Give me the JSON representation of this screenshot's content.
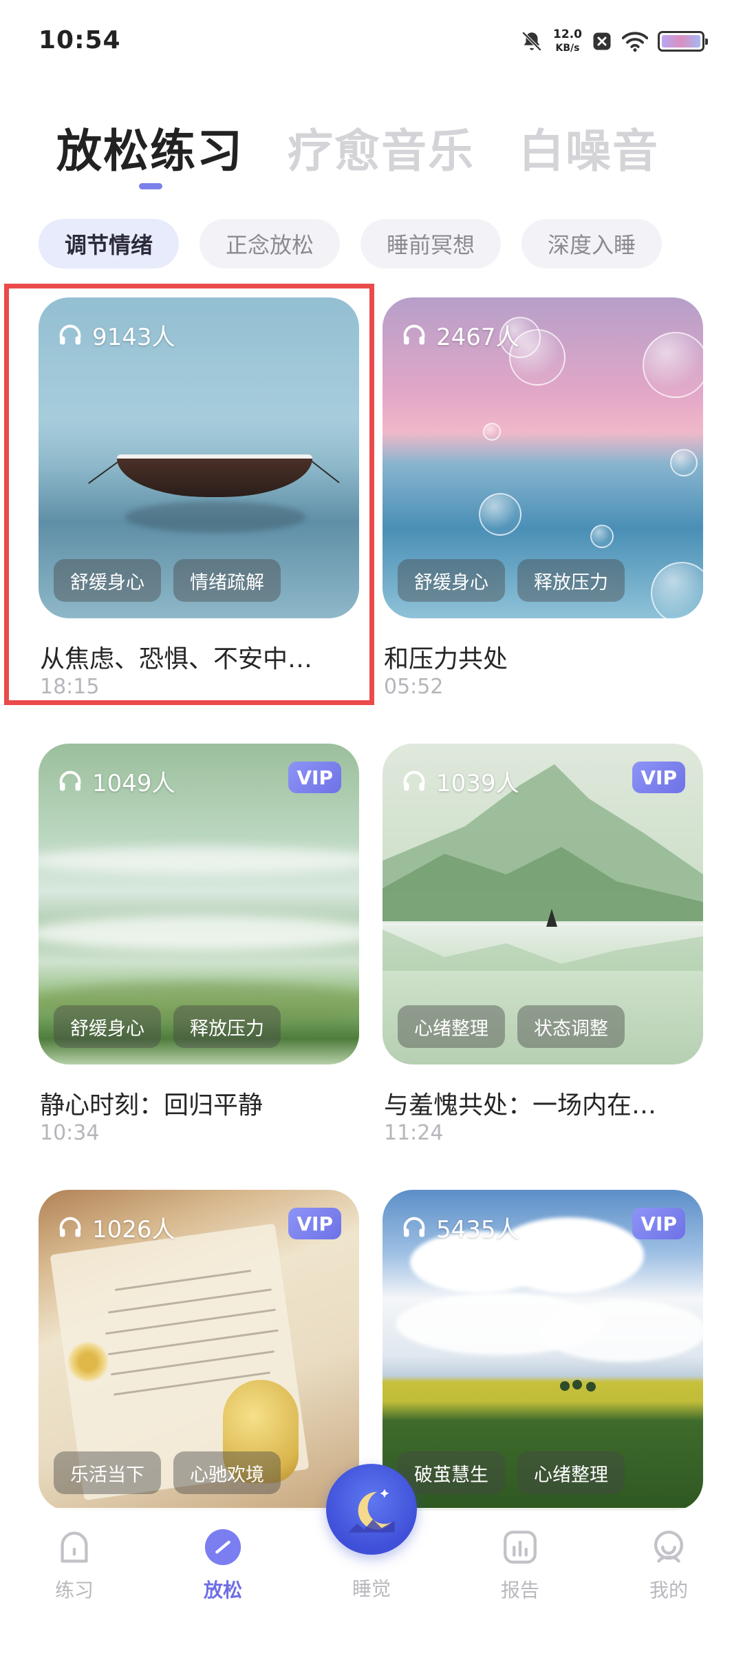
{
  "status_bar": {
    "time": "10:54",
    "speed_value": "12.0",
    "speed_unit": "KB/s",
    "battery_level": 1.0
  },
  "top_tabs": [
    {
      "label": "放松练习",
      "active": true
    },
    {
      "label": "疗愈音乐",
      "active": false
    },
    {
      "label": "白噪音",
      "active": false
    }
  ],
  "chips": [
    {
      "label": "调节情绪",
      "active": true
    },
    {
      "label": "正念放松",
      "active": false
    },
    {
      "label": "睡前冥想",
      "active": false
    },
    {
      "label": "深度入睡",
      "active": false
    }
  ],
  "cards": [
    {
      "listeners": "9143人",
      "vip": false,
      "tags": [
        "舒缓身心",
        "情绪疏解"
      ],
      "title": "从焦虑、恐惧、不安中…",
      "duration": "18:15"
    },
    {
      "listeners": "2467人",
      "vip": false,
      "tags": [
        "舒缓身心",
        "释放压力"
      ],
      "title": "和压力共处",
      "duration": "05:52"
    },
    {
      "listeners": "1049人",
      "vip": true,
      "vip_label": "VIP",
      "tags": [
        "舒缓身心",
        "释放压力"
      ],
      "title": "静心时刻：回归平静",
      "duration": "10:34"
    },
    {
      "listeners": "1039人",
      "vip": true,
      "vip_label": "VIP",
      "tags": [
        "心绪整理",
        "状态调整"
      ],
      "title": "与羞愧共处：一场内在…",
      "duration": "11:24"
    },
    {
      "listeners": "1026人",
      "vip": true,
      "vip_label": "VIP",
      "tags": [
        "乐活当下",
        "心驰欢境"
      ],
      "title": "",
      "duration": ""
    },
    {
      "listeners": "5435人",
      "vip": true,
      "vip_label": "VIP",
      "tags": [
        "破茧慧生",
        "心绪整理"
      ],
      "title": "",
      "duration": ""
    }
  ],
  "bottom_nav": [
    {
      "label": "练习",
      "icon": "practice-icon",
      "active": false
    },
    {
      "label": "放松",
      "icon": "relax-icon",
      "active": true
    },
    {
      "label": "睡觉",
      "icon": "moon-icon",
      "active": false
    },
    {
      "label": "报告",
      "icon": "report-icon",
      "active": false
    },
    {
      "label": "我的",
      "icon": "profile-icon",
      "active": false
    }
  ],
  "colors": {
    "accent": "#6d6fe3",
    "highlight_border": "#ea4a4a",
    "vip_badge": "#7b80ea"
  }
}
